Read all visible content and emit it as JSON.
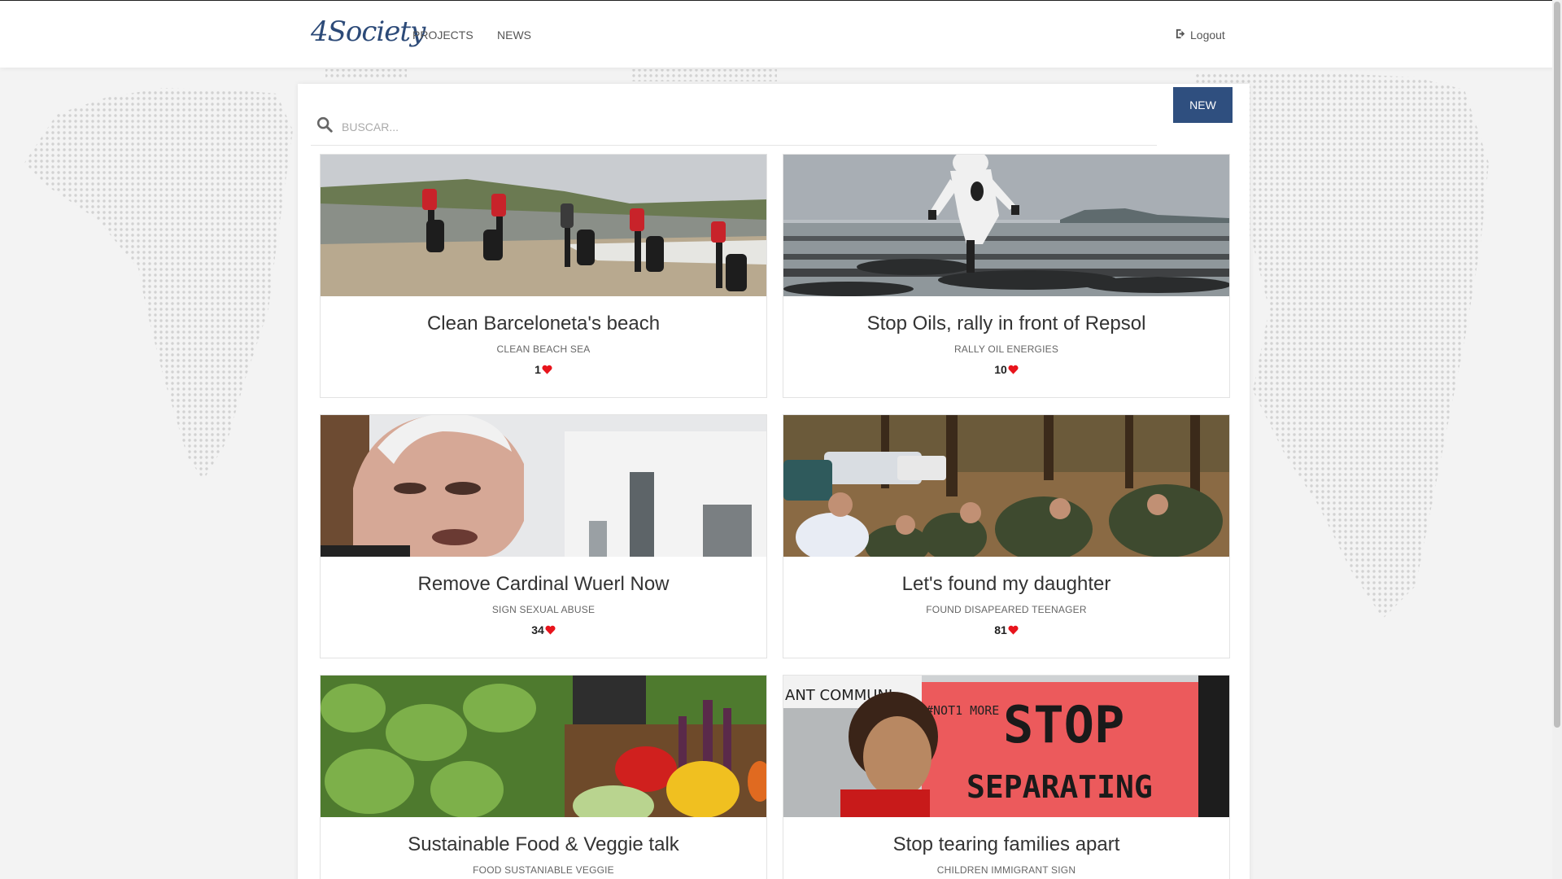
{
  "navbar": {
    "brand": "4Society",
    "links": [
      {
        "label": "PROJECTS"
      },
      {
        "label": "NEWS"
      }
    ],
    "logout_label": "Logout"
  },
  "toolbar": {
    "search_placeholder": "BUSCAR...",
    "new_label": "NEW"
  },
  "cards": [
    {
      "title": "Clean Barceloneta's beach",
      "tags": "CLEAN BEACH SEA",
      "likes": "1",
      "image": "beach-cleanup-photo"
    },
    {
      "title": "Stop Oils, rally in front of Repsol",
      "tags": "RALLY OIL ENERGIES",
      "likes": "10",
      "image": "oil-spill-photo"
    },
    {
      "title": "Remove Cardinal Wuerl Now",
      "tags": "SIGN SEXUAL ABUSE",
      "likes": "34",
      "image": "cardinal-portrait-photo"
    },
    {
      "title": "Let's found my daughter",
      "tags": "FOUND DISAPEARED TEENAGER",
      "likes": "81",
      "image": "search-party-photo"
    },
    {
      "title": "Sustainable Food & Veggie talk",
      "tags": "FOOD SUSTANIABLE VEGGIE",
      "likes": "",
      "image": "vegetables-photo"
    },
    {
      "title": "Stop tearing families apart",
      "tags": "CHILDREN IMMIGRANT SIGN",
      "likes": "",
      "image": "protest-sign-photo"
    }
  ],
  "image_text": {
    "sign_hashtag": "#NOT1 MORE",
    "sign_line1": "STOP",
    "sign_line2": "SEPARATING",
    "banner": "ANT COMMUNI"
  },
  "colors": {
    "brand": "#2c4a78",
    "new_button": "#2f4f7f",
    "heart": "#e8141c"
  },
  "icons": {
    "search": "search-icon",
    "logout": "sign-out-icon",
    "like": "heart-icon"
  }
}
